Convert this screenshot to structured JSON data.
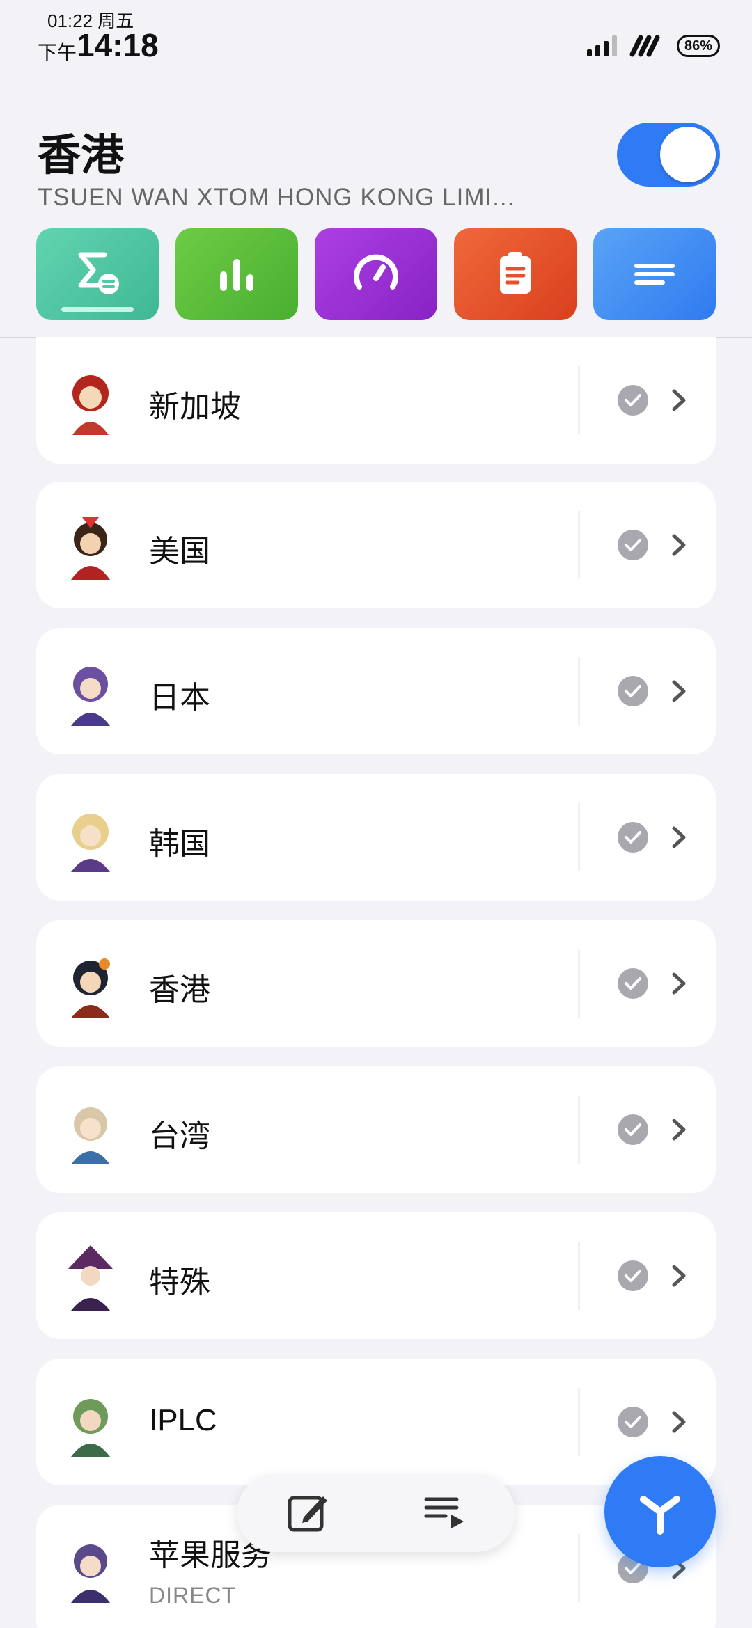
{
  "status_bar": {
    "small_time": "01:22 周五",
    "ampm": "下午",
    "time": "14:18",
    "battery": "86%"
  },
  "header": {
    "title": "香港",
    "subtitle": "TSUEN WAN XTOM HONG KONG LIMI...",
    "toggle_on": true
  },
  "toolbar": {
    "buttons": [
      {
        "icon": "sigma-icon",
        "color": "#4fc9a4"
      },
      {
        "icon": "bar-chart-icon",
        "color": "#5bbf3c"
      },
      {
        "icon": "speedometer-icon",
        "color": "#9b2fd6"
      },
      {
        "icon": "clipboard-icon",
        "color": "#e5522a"
      },
      {
        "icon": "menu-lines-icon",
        "color": "#3d8ef2"
      }
    ]
  },
  "groups": [
    {
      "name": "新加坡",
      "sub": ""
    },
    {
      "name": "美国",
      "sub": ""
    },
    {
      "name": "日本",
      "sub": ""
    },
    {
      "name": "韩国",
      "sub": ""
    },
    {
      "name": "香港",
      "sub": ""
    },
    {
      "name": "台湾",
      "sub": ""
    },
    {
      "name": "特殊",
      "sub": ""
    },
    {
      "name": "IPLC",
      "sub": ""
    },
    {
      "name": "苹果服务",
      "sub": "DIRECT"
    }
  ],
  "colors": {
    "accent": "#2f7bf5",
    "background": "#f2f2f7",
    "check_gray": "#a8a8ae"
  }
}
